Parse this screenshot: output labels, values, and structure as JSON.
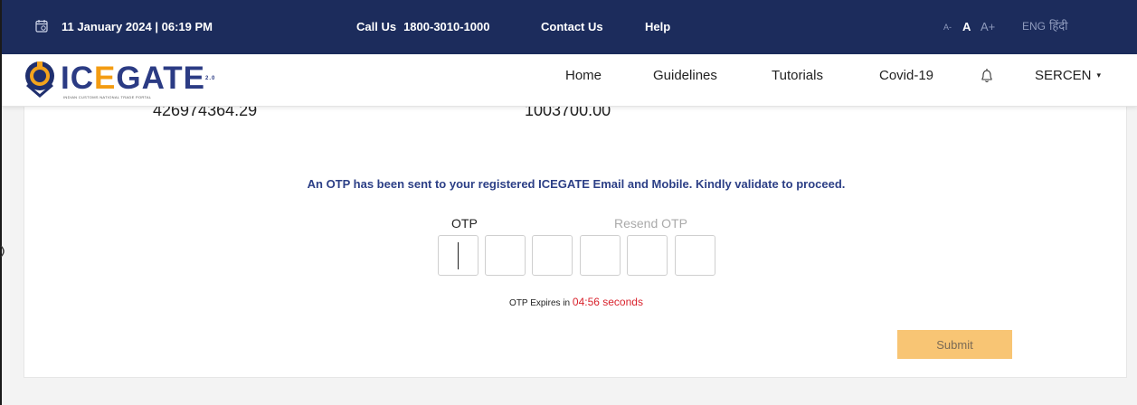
{
  "topbar": {
    "datetime": "11 January 2024 | 06:19 PM",
    "call_label": "Call Us",
    "call_number": "1800-3010-1000",
    "contact": "Contact Us",
    "help": "Help",
    "font_small": "A-",
    "font_normal": "A",
    "font_large": "A+",
    "lang_en": "ENG",
    "lang_hi": "हिंदी",
    "bg_color": "#1c2c5c"
  },
  "logo": {
    "word_ice": "IC",
    "word_mark": "E",
    "word_gate": "GATE",
    "suffix": "2.0",
    "tagline": "INDIAN CUSTOMS NATIONAL TRADE PORTAL"
  },
  "nav": {
    "home": "Home",
    "guidelines": "Guidelines",
    "tutorials": "Tutorials",
    "covid": "Covid-19",
    "user": "SERCEN",
    "user_caret": "▾"
  },
  "content": {
    "amount_1": "426974364.29",
    "amount_2": "1003700.00",
    "otp_message": "An OTP has been sent to your registered ICEGATE Email and Mobile. Kindly validate to proceed.",
    "otp_label": "OTP",
    "resend_label": "Resend OTP",
    "otp_values": [
      "",
      "",
      "",
      "",
      "",
      ""
    ],
    "expires_prefix": "OTP Expires in",
    "expires_timer": "04:56 seconds",
    "submit_label": "Submit",
    "accent_color": "#2c3f86",
    "timer_color": "#d9232d",
    "submit_color": "#f8c574"
  }
}
